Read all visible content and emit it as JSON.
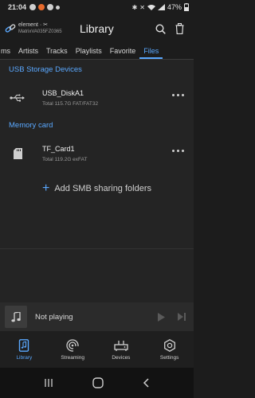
{
  "status_bar": {
    "time": "21:04",
    "battery": "47%",
    "left_icon_colors": [
      "#cfcfcf",
      "#e86a2c",
      "#cfcfcf",
      "#cfcfcf"
    ]
  },
  "header": {
    "device_name": "element · ✂",
    "device_id": "MatrixVA035FZ0365",
    "title": "Library",
    "icons": [
      "search-icon",
      "trash-icon"
    ]
  },
  "tabs": [
    {
      "label": "ms",
      "active": false
    },
    {
      "label": "Artists",
      "active": false
    },
    {
      "label": "Tracks",
      "active": false
    },
    {
      "label": "Playlists",
      "active": false
    },
    {
      "label": "Favorite",
      "active": false
    },
    {
      "label": "Files",
      "active": true
    }
  ],
  "sections": {
    "usb": {
      "title": "USB Storage Devices",
      "items": [
        {
          "name": "USB_DiskA1",
          "detail": "Total 115.7G  FAT/FAT32",
          "icon": "usb-icon"
        }
      ]
    },
    "memory": {
      "title": "Memory card",
      "items": [
        {
          "name": "TF_Card1",
          "detail": "Total 119.2G  exFAT",
          "icon": "sd-card-icon"
        }
      ]
    }
  },
  "add_smb_label": "Add SMB sharing folders",
  "player": {
    "status": "Not playing",
    "icons": [
      "music-note-icon",
      "play-icon",
      "next-icon"
    ]
  },
  "bottom_nav": [
    {
      "label": "Library",
      "icon": "library-icon",
      "active": true
    },
    {
      "label": "Streaming",
      "icon": "streaming-icon",
      "active": false
    },
    {
      "label": "Devices",
      "icon": "devices-icon",
      "active": false
    },
    {
      "label": "Settings",
      "icon": "settings-icon",
      "active": false
    }
  ],
  "colors": {
    "accent": "#5aa8ff",
    "background": "#1c1c1c",
    "content_background": "#242424"
  }
}
